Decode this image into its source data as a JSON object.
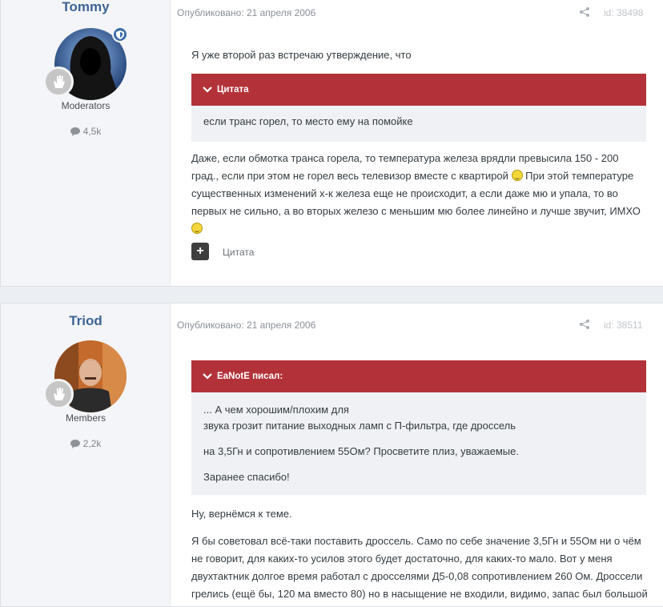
{
  "posts": [
    {
      "author": "Tommy",
      "group": "Moderators",
      "post_count": "4,5k",
      "published": "Опубликовано: 21 апреля 2006",
      "post_id": "id: 38498",
      "intro": "Я уже второй раз встречаю утверждение, что",
      "quote_title": "Цитата",
      "quote_lines": [
        "если транс горел, то место ему на помойке"
      ],
      "body_part1": "Даже, если обмотка транса горела, то температура железа врядли превысила 150 - 200 град., если при этом не горел весь телевизор вместе с квартирой",
      "body_part2": " При этой температуре существенных изменений х-к железа еще не происходит, а если даже мю и упала, то во первых не сильно, а во вторых железо с меньшим мю более линейно и лучше звучит, ИМХО ",
      "quote_button_label": "Цитата"
    },
    {
      "author": "Triod",
      "group": "Members",
      "post_count": "2,2k",
      "published": "Опубликовано: 21 апреля 2006",
      "post_id": "id: 38511",
      "quote_title": "EaNotE писал:",
      "quote_lines": [
        "... А чем хорошим/плохим для",
        "звука грозит питание выходных ламп с П-фильтра, где дроссель",
        "на 3,5Гн и сопротивлением 55Ом? Просветите плиз, уважаемые.",
        "Заранее спасибо!"
      ],
      "reply1": "Ну, вернёмся к теме.",
      "reply2": "Я бы советовал всё-таки поставить дроссель. Само по себе значение 3,5Гн и 55Ом ни о чём не говорит, для каких-то усилов этого будет достаточно, для каких-то мало. Вот у меня двухтактник долгое время работал с дросселями Д5-0,08 сопротивлением 260 Ом. Дроссели грелись (ещё бы, 120 ма вместо 80) но в насыщение не входили, видимо, запас был большой"
    }
  ],
  "colors": {
    "quote_header": "#b33239",
    "author_name": "#3d6594",
    "author_panel": "#f4f5f8"
  },
  "icons": [
    "shield-icon",
    "hand-icon",
    "comment-icon",
    "share-icon",
    "chevron-down-icon",
    "plus-icon",
    "smiley-icon"
  ]
}
